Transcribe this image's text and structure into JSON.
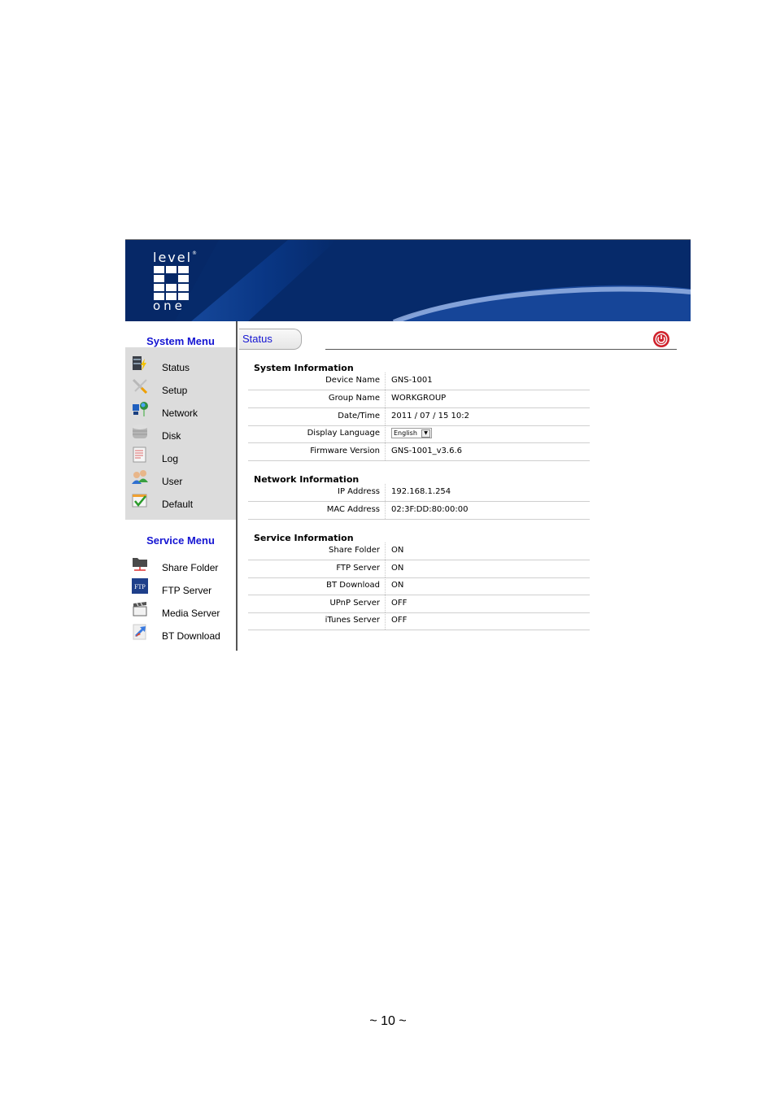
{
  "branding": {
    "logo_top": "level",
    "logo_bottom": "one",
    "registered_mark": "®"
  },
  "colors": {
    "banner_bg": "#062a6a",
    "menu_title": "#1414d2",
    "menu_panel_bg": "#dcdcdc",
    "logout_red": "#d0202a"
  },
  "sidebar": {
    "system_menu_title": "System Menu",
    "system_items": [
      {
        "label": "Status",
        "icon": "status-icon"
      },
      {
        "label": "Setup",
        "icon": "setup-tools-icon"
      },
      {
        "label": "Network",
        "icon": "network-icon"
      },
      {
        "label": "Disk",
        "icon": "disk-icon"
      },
      {
        "label": "Log",
        "icon": "log-icon"
      },
      {
        "label": "User",
        "icon": "users-icon"
      },
      {
        "label": "Default",
        "icon": "default-check-icon"
      }
    ],
    "service_menu_title": "Service Menu",
    "service_items": [
      {
        "label": "Share Folder",
        "icon": "share-folder-icon"
      },
      {
        "label": "FTP Server",
        "icon": "ftp-icon",
        "icon_text": "FTP"
      },
      {
        "label": "Media Server",
        "icon": "media-clapper-icon"
      },
      {
        "label": "BT Download",
        "icon": "bt-download-icon"
      }
    ]
  },
  "main": {
    "tab_label": "Status",
    "logout_icon": "power-icon",
    "sections": [
      {
        "title": "System Information",
        "rows": [
          {
            "key": "Device Name",
            "value": "GNS-1001"
          },
          {
            "key": "Group Name",
            "value": "WORKGROUP"
          },
          {
            "key": "Date/Time",
            "value": "2011 / 07 / 15 10:2"
          },
          {
            "key": "Display Language",
            "value": "English",
            "type": "select"
          },
          {
            "key": "Firmware Version",
            "value": "GNS-1001_v3.6.6"
          }
        ]
      },
      {
        "title": "Network Information",
        "rows": [
          {
            "key": "IP Address",
            "value": "192.168.1.254"
          },
          {
            "key": "MAC Address",
            "value": "02:3F:DD:80:00:00"
          }
        ]
      },
      {
        "title": "Service Information",
        "rows": [
          {
            "key": "Share Folder",
            "value": "ON"
          },
          {
            "key": "FTP Server",
            "value": "ON"
          },
          {
            "key": "BT Download",
            "value": "ON"
          },
          {
            "key": "UPnP Server",
            "value": "OFF"
          },
          {
            "key": "iTunes Server",
            "value": "OFF"
          }
        ]
      }
    ]
  },
  "page_number": "~ 10 ~"
}
